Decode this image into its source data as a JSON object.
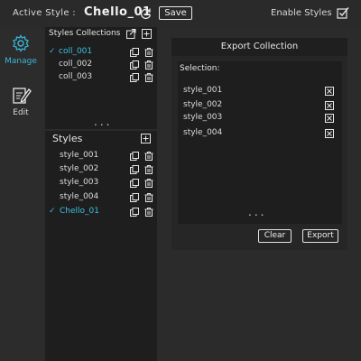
{
  "topbar": {
    "active_style_label": "Active Style :",
    "active_style_name": "Chello_01",
    "save_label": "Save",
    "enable_label": "Enable Styles"
  },
  "sidebar": {
    "items": [
      {
        "label": "Manage",
        "icon": "gear-icon",
        "active": true
      },
      {
        "label": "Edit",
        "icon": "edit-icon",
        "active": false
      }
    ]
  },
  "collections": {
    "title": "Styles Collections",
    "items": [
      {
        "label": "coll_001",
        "selected": true
      },
      {
        "label": "coll_002",
        "selected": false
      },
      {
        "label": "coll_003",
        "selected": false
      }
    ],
    "more": "..."
  },
  "styles": {
    "title": "Styles",
    "items": [
      {
        "label": "style_001",
        "selected": false
      },
      {
        "label": "style_002",
        "selected": false
      },
      {
        "label": "style_003",
        "selected": false
      },
      {
        "label": "style_004",
        "selected": false
      },
      {
        "label": "Chello_01",
        "selected": true
      }
    ]
  },
  "export": {
    "title": "Export Collection",
    "selection_label": "Selection:",
    "items": [
      "style_001",
      "style_002",
      "style_003",
      "style_004"
    ],
    "more": "...",
    "clear_label": "Clear",
    "export_label": "Export"
  },
  "colors": {
    "accent": "#39b6d6",
    "background": "#2b2b2b",
    "panel": "#1e1e1e"
  }
}
